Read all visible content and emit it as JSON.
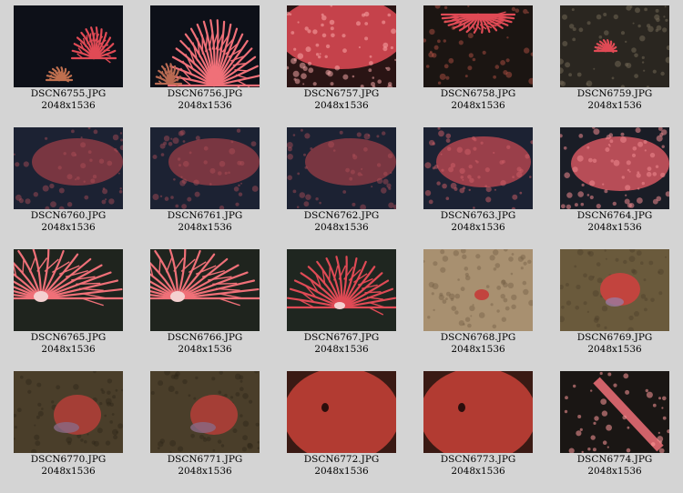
{
  "gallery": {
    "items": [
      {
        "filename": "DSCN6755.JPG",
        "dimensions": "2048x1536",
        "scene": "fan-small"
      },
      {
        "filename": "DSCN6756.JPG",
        "dimensions": "2048x1536",
        "scene": "fan-large"
      },
      {
        "filename": "DSCN6757.JPG",
        "dimensions": "2048x1536",
        "scene": "fan-closeup"
      },
      {
        "filename": "DSCN6758.JPG",
        "dimensions": "2048x1536",
        "scene": "fan-top"
      },
      {
        "filename": "DSCN6759.JPG",
        "dimensions": "2048x1536",
        "scene": "seafloor-small"
      },
      {
        "filename": "DSCN6760.JPG",
        "dimensions": "2048x1536",
        "scene": "fan-dim"
      },
      {
        "filename": "DSCN6761.JPG",
        "dimensions": "2048x1536",
        "scene": "fan-dim"
      },
      {
        "filename": "DSCN6762.JPG",
        "dimensions": "2048x1536",
        "scene": "fan-dim"
      },
      {
        "filename": "DSCN6763.JPG",
        "dimensions": "2048x1536",
        "scene": "fan-mid"
      },
      {
        "filename": "DSCN6764.JPG",
        "dimensions": "2048x1536",
        "scene": "fan-bright"
      },
      {
        "filename": "DSCN6765.JPG",
        "dimensions": "2048x1536",
        "scene": "fan-branch"
      },
      {
        "filename": "DSCN6766.JPG",
        "dimensions": "2048x1536",
        "scene": "fan-branch"
      },
      {
        "filename": "DSCN6767.JPG",
        "dimensions": "2048x1536",
        "scene": "fan-branch-far"
      },
      {
        "filename": "DSCN6768.JPG",
        "dimensions": "2048x1536",
        "scene": "sand-octopus-small"
      },
      {
        "filename": "DSCN6769.JPG",
        "dimensions": "2048x1536",
        "scene": "octopus"
      },
      {
        "filename": "DSCN6770.JPG",
        "dimensions": "2048x1536",
        "scene": "octopus-dark"
      },
      {
        "filename": "DSCN6771.JPG",
        "dimensions": "2048x1536",
        "scene": "octopus-dark"
      },
      {
        "filename": "DSCN6772.JPG",
        "dimensions": "2048x1536",
        "scene": "octopus-closeup"
      },
      {
        "filename": "DSCN6773.JPG",
        "dimensions": "2048x1536",
        "scene": "octopus-closeup"
      },
      {
        "filename": "DSCN6774.JPG",
        "dimensions": "2048x1536",
        "scene": "fan-diagonal"
      }
    ]
  },
  "colors": {
    "background": "#d4d4d4",
    "coral": "#e04a55",
    "coral_bright": "#f07078",
    "deep_water": "#0d1018",
    "dim_water": "#1c2233",
    "sand": "#9a8360",
    "octopus": "#c2443e"
  }
}
